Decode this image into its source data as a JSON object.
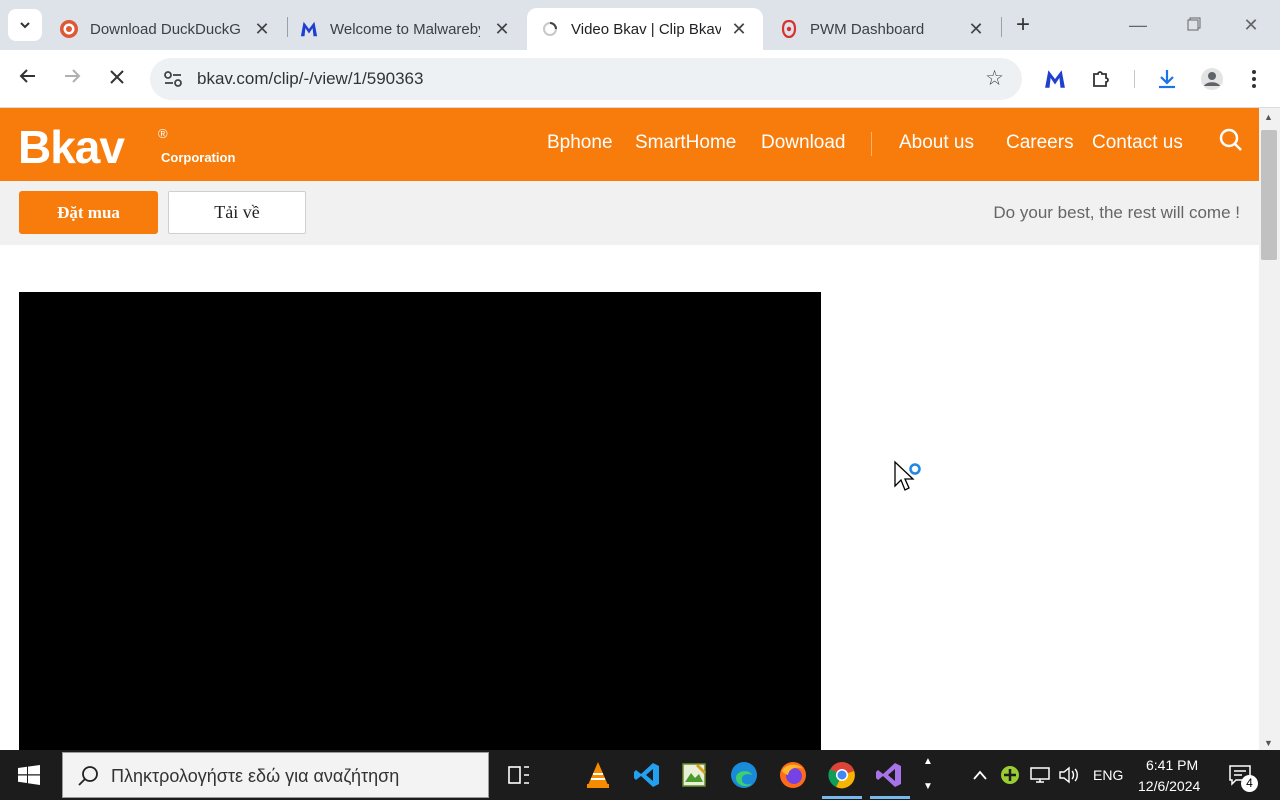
{
  "browser": {
    "tabs": [
      {
        "title": "Download DuckDuckGo",
        "icon": "duckduckgo-icon",
        "active": false
      },
      {
        "title": "Welcome to Malwarebytes",
        "icon": "malwarebytes-icon",
        "active": false
      },
      {
        "title": "Video Bkav | Clip Bkav",
        "icon": "loading-icon",
        "active": true
      },
      {
        "title": "PWM Dashboard",
        "icon": "pwm-icon",
        "active": false
      }
    ],
    "url": "bkav.com/clip/-/view/1/590363"
  },
  "site": {
    "logo": "Bkav",
    "logo_reg": "®",
    "logo_sub": "Corporation",
    "nav": [
      "Bphone",
      "SmartHome",
      "Download",
      "About us",
      "Careers",
      "Contact us"
    ],
    "buy_button": "Đặt mua",
    "download_button": "Tải về",
    "tagline": "Do your best, the rest will come !"
  },
  "taskbar": {
    "search_placeholder": "Πληκτρολογήστε εδώ για αναζήτηση",
    "language": "ENG",
    "time": "6:41 PM",
    "date": "12/6/2024",
    "notifications": "4"
  },
  "colors": {
    "brand_orange": "#f77c0b",
    "tabstrip": "#dee3ea",
    "taskbar": "#1c1c1c"
  }
}
